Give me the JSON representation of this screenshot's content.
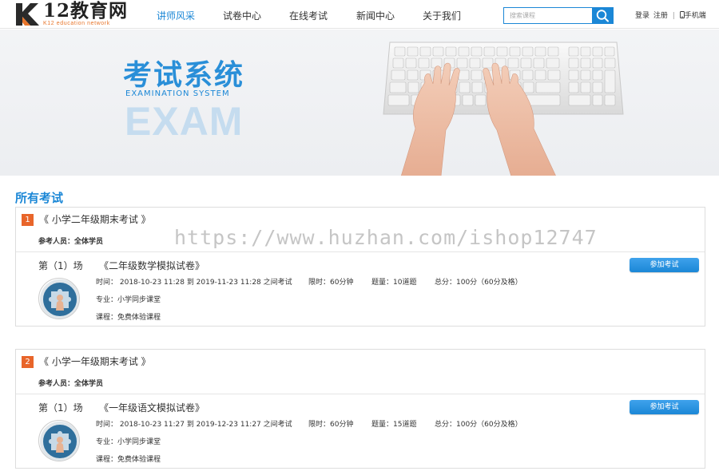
{
  "brand": {
    "name": "12教育网",
    "tagline": "K12 education network",
    "accent": "#1b87d6",
    "orange": "#e8652a"
  },
  "nav": {
    "items": [
      {
        "label": "讲师风采",
        "active": true
      },
      {
        "label": "试卷中心",
        "active": false
      },
      {
        "label": "在线考试",
        "active": false
      },
      {
        "label": "新闻中心",
        "active": false
      },
      {
        "label": "关于我们",
        "active": false
      }
    ]
  },
  "search": {
    "placeholder": "搜索课程",
    "icon": "search-icon"
  },
  "top_links": {
    "login": "登录",
    "register": "注册",
    "separator": "|",
    "mobile": "手机端",
    "mobile_icon": "phone-icon"
  },
  "banner": {
    "title": "考试系统",
    "subtitle": "EXAMINATION SYSTEM",
    "big": "EXAM"
  },
  "section": {
    "title": "所有考试"
  },
  "exams": [
    {
      "index": "1",
      "name": "《 小学二年级期末考试 》",
      "participants": "参考人员：全体学员",
      "session": "第（1）场",
      "paper": "《二年级数学模拟试卷》",
      "join_label": "参加考试",
      "time": "时间： 2018-10-23 11:28 到 2019-11-23 11:28 之间考试",
      "limit": "限时：60分钟",
      "count": "题量：10道题",
      "score": "总分：100分（60分及格）",
      "major": "专业：小学同步课堂",
      "course": "课程：免费体验课程"
    },
    {
      "index": "2",
      "name": "《 小学一年级期末考试 》",
      "participants": "参考人员：全体学员",
      "session": "第（1）场",
      "paper": "《一年级语文模拟试卷》",
      "join_label": "参加考试",
      "time": "时间： 2018-10-23 11:27 到 2019-12-23 11:27 之间考试",
      "limit": "限时：60分钟",
      "count": "题量：15道题",
      "score": "总分：100分（60分及格）",
      "major": "专业：小学同步课堂",
      "course": "课程：免费体验课程"
    }
  ],
  "watermark": "https://www.huzhan.com/ishop12747"
}
